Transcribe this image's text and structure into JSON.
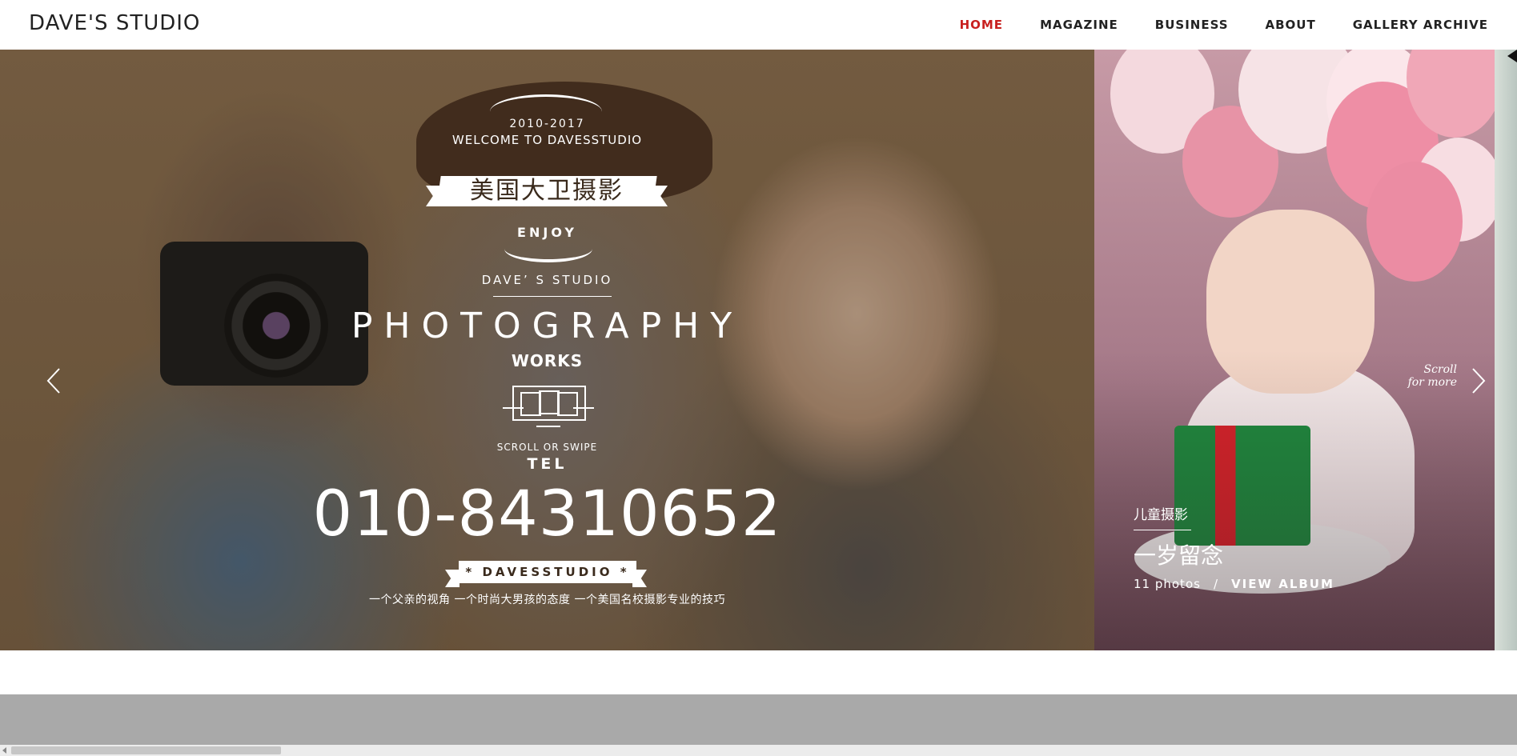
{
  "header": {
    "logo": "DAVE'S STUDIO",
    "nav": [
      {
        "label": "HOME",
        "active": true
      },
      {
        "label": "MAGAZINE",
        "active": false
      },
      {
        "label": "BUSINESS",
        "active": false
      },
      {
        "label": "ABOUT",
        "active": false
      },
      {
        "label": "GALLERY ARCHIVE",
        "active": false
      }
    ],
    "active_color": "#c8201f"
  },
  "hero": {
    "years": "2010-2017",
    "welcome": "WELCOME TO DAVESSTUDIO",
    "ribbon_text": "美国大卫摄影",
    "enjoy": "ENJOY",
    "dave": "DAVE’ S STUDIO",
    "photography": "PHOTOGRAPHY",
    "works": "WORKS",
    "scroll_swipe": "SCROLL OR SWIPE",
    "tel_label": "TEL",
    "phone": "010-84310652",
    "brand_ribbon": "* DAVESSTUDIO *",
    "slogan": "一个父亲的视角  一个时尚大男孩的态度  一个美国名校摄影专业的技巧"
  },
  "side_slide": {
    "scroll_more_1": "Scroll",
    "scroll_more_2": "for more",
    "category": "儿童摄影",
    "title": "一岁留念",
    "photo_count": "11 photos",
    "separator": "/",
    "view_album": "VIEW ALBUM"
  },
  "icons": {
    "prev": "chevron-left-icon",
    "next": "chevron-right-icon",
    "monitor": "monitor-swipe-icon"
  }
}
